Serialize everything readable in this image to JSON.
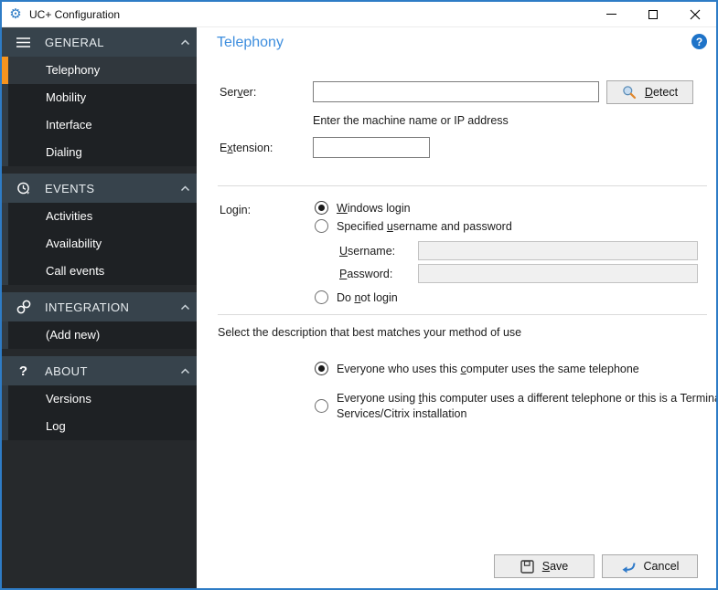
{
  "window": {
    "title": "UC+ Configuration"
  },
  "icons": {
    "gear": "⚙",
    "help": "?",
    "about": "?",
    "minimize": "line-shape",
    "maximize": "box-shape",
    "close": "x-shape",
    "general": "hamburger-lines",
    "events": "clock-history",
    "integration": "chain-links",
    "save": "floppy-disk",
    "cancel": "undo-arrow",
    "detect": "magnifier"
  },
  "colors": {
    "window_border": "#2E7CC6",
    "sidebar_base": "#26292C",
    "sidebar_header": "#37434C",
    "sidebar_item": "#1E2124",
    "sidebar_selected": "#30373D",
    "selected_accent_orange": "#F7941E",
    "heading_blue": "#3E8EDE",
    "help_icon_blue": "#1E73C8"
  },
  "sidebar": {
    "sections": [
      {
        "label": "GENERAL",
        "items": [
          {
            "label": "Telephony",
            "selected": true
          },
          {
            "label": "Mobility",
            "selected": false
          },
          {
            "label": "Interface",
            "selected": false
          },
          {
            "label": "Dialing",
            "selected": false
          }
        ]
      },
      {
        "label": "EVENTS",
        "items": [
          {
            "label": "Activities",
            "selected": false
          },
          {
            "label": "Availability",
            "selected": false
          },
          {
            "label": "Call events",
            "selected": false
          }
        ]
      },
      {
        "label": "INTEGRATION",
        "items": [
          {
            "label": "(Add new)",
            "selected": false
          }
        ]
      },
      {
        "label": "ABOUT",
        "items": [
          {
            "label": "Versions",
            "selected": false
          },
          {
            "label": "Log",
            "selected": false
          }
        ]
      }
    ]
  },
  "main": {
    "title": "Telephony",
    "server": {
      "label": {
        "pre": "Ser",
        "key": "v",
        "post": "er:"
      },
      "value": "",
      "help": "Enter the machine name or IP address",
      "detect_label": {
        "pre": "",
        "key": "D",
        "post": "etect"
      }
    },
    "extension": {
      "label": {
        "pre": "E",
        "key": "x",
        "post": "tension:"
      },
      "value": ""
    },
    "login": {
      "label": "Login:",
      "options": [
        {
          "label": {
            "pre": "",
            "key": "W",
            "post": "indows login"
          },
          "selected": true
        },
        {
          "label": {
            "pre": "Specified ",
            "key": "u",
            "post": "sername and password"
          },
          "selected": false
        },
        {
          "label": {
            "pre": "Do ",
            "key": "n",
            "post": "ot login"
          },
          "selected": false
        }
      ],
      "username": {
        "label": {
          "pre": "",
          "key": "U",
          "post": "sername:"
        },
        "value": ""
      },
      "password": {
        "label": {
          "pre": "",
          "key": "P",
          "post": "assword:"
        },
        "value": ""
      }
    },
    "usage": {
      "prompt": "Select the description that best matches your method of use",
      "options": [
        {
          "label": {
            "pre": "Everyone who uses this ",
            "key": "c",
            "post": "omputer uses the same telephone"
          },
          "selected": true
        },
        {
          "label": {
            "pre": "Everyone using ",
            "key": "t",
            "post": "his computer uses a different telephone or this is a Terminal Services/Citrix installation"
          },
          "selected": false
        }
      ]
    },
    "actions": {
      "save": {
        "pre": "",
        "key": "S",
        "post": "ave"
      },
      "cancel": "Cancel"
    }
  }
}
